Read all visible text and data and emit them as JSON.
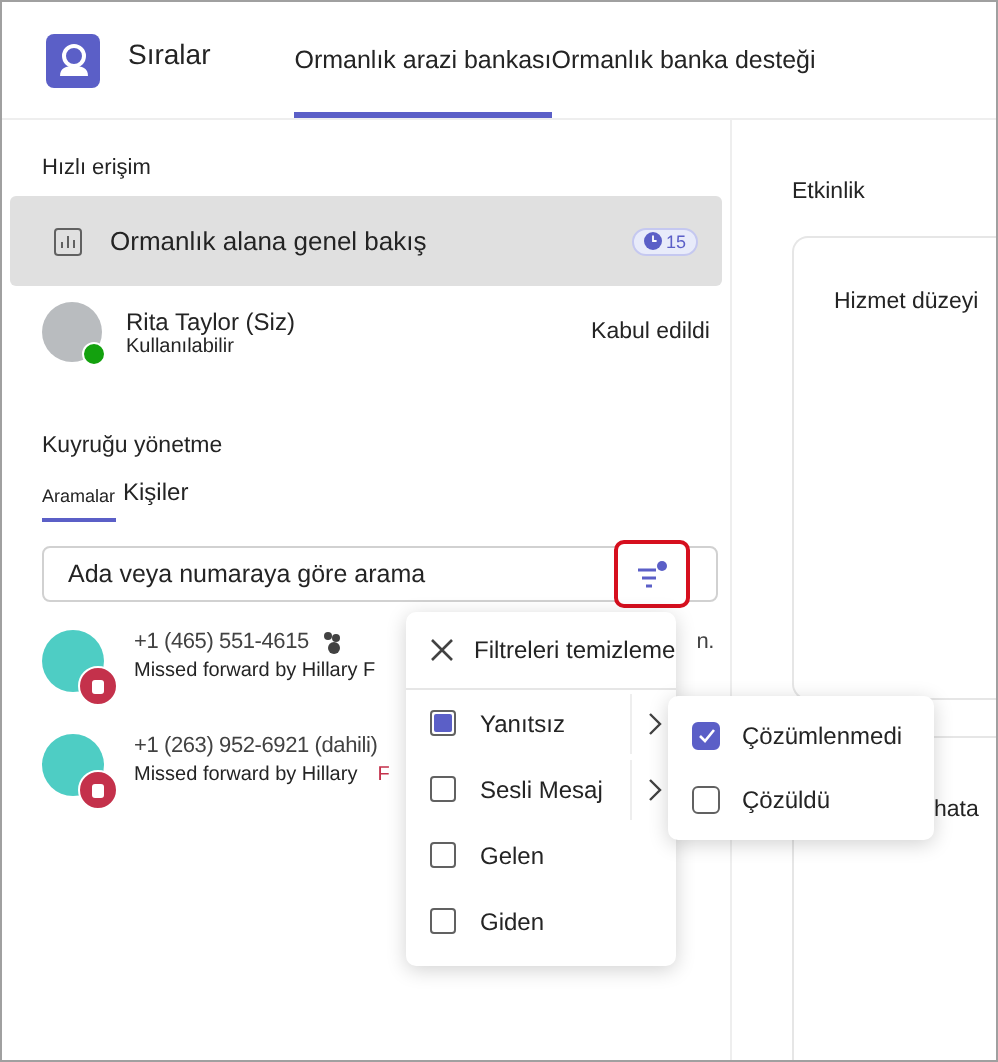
{
  "header": {
    "app_title": "Sıralar",
    "tabs": [
      {
        "label": "Ormanlık arazi bankası",
        "selected": true
      },
      {
        "label": "Ormanlık banka desteği",
        "selected": false
      }
    ]
  },
  "quick_access": {
    "title": "Hızlı erişim",
    "item": {
      "label": "Ormanlık alana genel bakış",
      "badge": "15",
      "selected": true
    }
  },
  "user": {
    "name": "Rita Taylor (Siz)",
    "presence": "Kullanılabilir",
    "available": true,
    "status": "Kabul edildi"
  },
  "queue": {
    "title": "Kuyruğu yönetme",
    "tabs": [
      {
        "label": "Aramalar",
        "selected": true
      },
      {
        "label": "Kişiler",
        "selected": false
      }
    ],
    "search": {
      "placeholder": "Ada veya numaraya göre arama"
    },
    "calls": [
      {
        "number": "+1 (465) 551-4615",
        "detail": "Missed forward by Hillary F",
        "trailing": "n.",
        "kind": "note"
      },
      {
        "number": "+1 (263) 952-6921 (dahili)",
        "detail": "Missed forward by Hillary",
        "trailing": "F",
        "kind": "tag"
      }
    ]
  },
  "filter_menu": {
    "clear": "Filtreleri temizleme",
    "items": [
      {
        "label": "Yanıtsız",
        "checked": true,
        "submenu": true
      },
      {
        "label": "Sesli Mesaj",
        "checked": false,
        "submenu": true
      },
      {
        "label": "Gelen",
        "checked": false,
        "submenu": false
      },
      {
        "label": "Giden",
        "checked": false,
        "submenu": false
      }
    ],
    "submenu": [
      {
        "label": "Çözümlenmedi",
        "checked": true
      },
      {
        "label": "Çözüldü",
        "checked": false
      }
    ]
  },
  "activity": {
    "title": "Etkinlik",
    "card_title": "Hizmet düzeyi",
    "second_card_text": "hata"
  }
}
